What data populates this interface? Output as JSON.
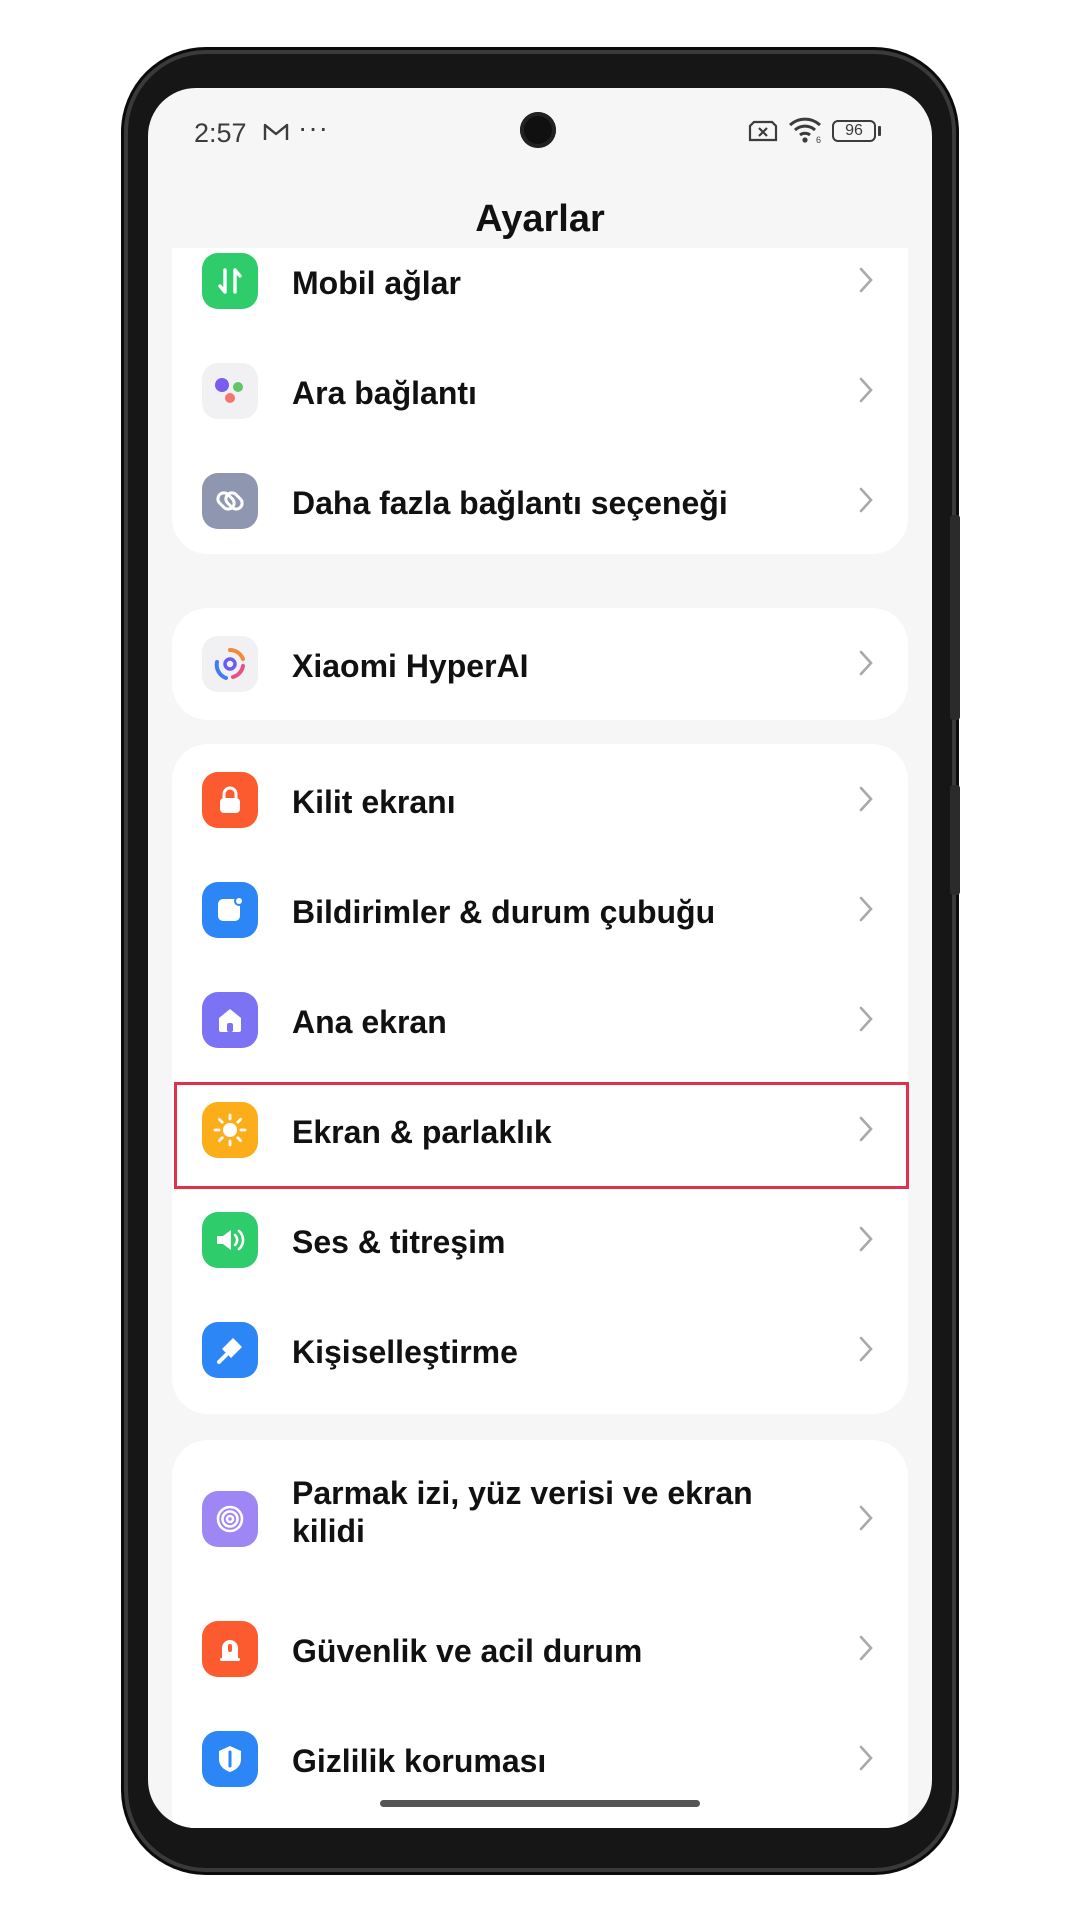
{
  "status_bar": {
    "time": "2:57",
    "more": "···",
    "battery": "96"
  },
  "title": "Ayarlar",
  "groups": [
    {
      "items": [
        {
          "label": "Mobil ağlar",
          "icon": "mobile-data-icon",
          "color": "#2ecc6a"
        },
        {
          "label": "Ara bağlantı",
          "icon": "interconnect-icon",
          "color": "#f1f1f4"
        },
        {
          "label": "Daha fazla bağlantı seçeneği",
          "icon": "link-icon",
          "color": "#8f97b0"
        }
      ]
    },
    {
      "items": [
        {
          "label": "Xiaomi HyperAI",
          "icon": "hyperai-icon",
          "color": "#f1f1f4"
        }
      ]
    },
    {
      "items": [
        {
          "label": "Kilit ekranı",
          "icon": "lock-icon",
          "color": "#fb5b2e"
        },
        {
          "label": "Bildirimler & durum çubuğu",
          "icon": "notification-icon",
          "color": "#2d86f5"
        },
        {
          "label": "Ana ekran",
          "icon": "home-icon",
          "color": "#7c72f4"
        },
        {
          "label": "Ekran & parlaklık",
          "icon": "sun-icon",
          "color": "#fcae1a"
        },
        {
          "label": "Ses & titreşim",
          "icon": "speaker-icon",
          "color": "#2ecc6a"
        },
        {
          "label": "Kişiselleştirme",
          "icon": "brush-icon",
          "color": "#2d86f5"
        }
      ]
    },
    {
      "items": [
        {
          "label": "Parmak izi, yüz verisi ve ekran kilidi",
          "icon": "fingerprint-icon",
          "color": "#9e87f5"
        },
        {
          "label": "Güvenlik ve acil durum",
          "icon": "emergency-icon",
          "color": "#fb5b2e"
        },
        {
          "label": "Gizlilik koruması",
          "icon": "privacy-icon",
          "color": "#2d86f5"
        }
      ]
    }
  ],
  "highlight_color": "#e0304a"
}
